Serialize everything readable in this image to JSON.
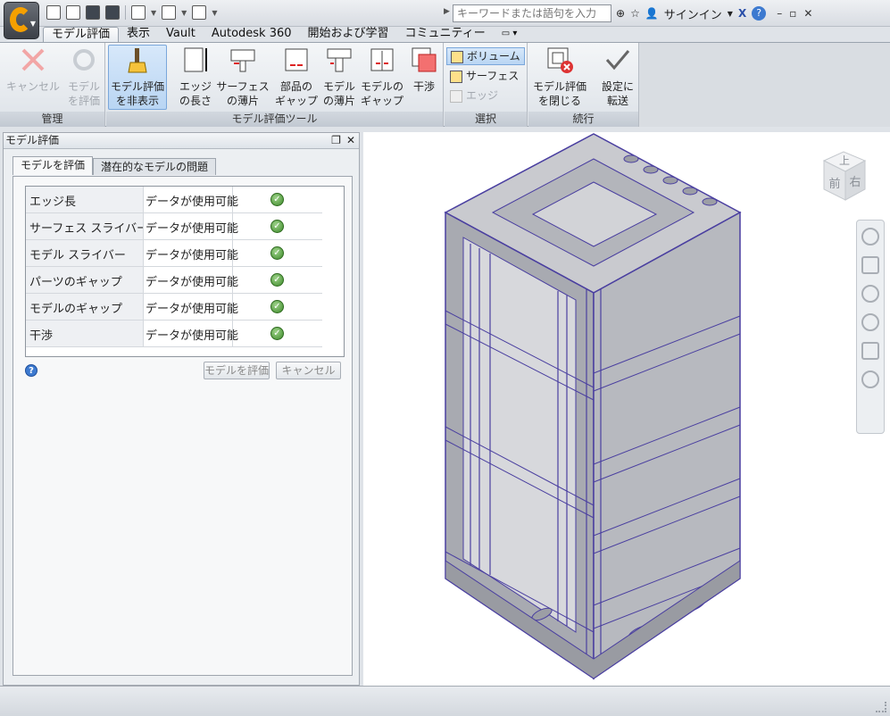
{
  "title_bar": {
    "search_placeholder": "キーワードまたは語句を入力",
    "signin_label": "サインイン"
  },
  "ribbon_tabs": [
    "モデル評価",
    "表示",
    "Vault",
    "Autodesk 360",
    "開始および学習",
    "コミュニティー"
  ],
  "ribbon": {
    "manage_panel": {
      "title": "管理",
      "cancel_label": "キャンセル",
      "evaluate_label_1": "モデル",
      "evaluate_label_2": "を評価"
    },
    "tools_panel": {
      "title": "モデル評価ツール",
      "hide_label_1": "モデル評価",
      "hide_label_2": "を非表示",
      "edge_length_1": "エッジ",
      "edge_length_2": "の長さ",
      "surface_sliver_1": "サーフェス",
      "surface_sliver_2": "の薄片",
      "part_gap_1": "部品の",
      "part_gap_2": "ギャップ",
      "model_sliver_1": "モデル",
      "model_sliver_2": "の薄片",
      "model_gap_1": "モデルの",
      "model_gap_2": "ギャップ",
      "interference": "干渉"
    },
    "select_panel": {
      "title": "選択",
      "volume": "ボリューム",
      "surface": "サーフェス",
      "edge": "エッジ"
    },
    "continue_panel": {
      "title": "続行",
      "close_1": "モデル評価",
      "close_2": "を閉じる",
      "transfer_1": "設定に",
      "transfer_2": "転送"
    }
  },
  "left_panel": {
    "title": "モデル評価",
    "tabs": [
      "モデルを評価",
      "潜在的なモデルの問題"
    ],
    "rows": [
      {
        "name": "エッジ長",
        "status": "データが使用可能"
      },
      {
        "name": "サーフェス スライバー",
        "status": "データが使用可能"
      },
      {
        "name": "モデル スライバー",
        "status": "データが使用可能"
      },
      {
        "name": "パーツのギャップ",
        "status": "データが使用可能"
      },
      {
        "name": "モデルのギャップ",
        "status": "データが使用可能"
      },
      {
        "name": "干渉",
        "status": "データが使用可能"
      }
    ],
    "help_label": "?",
    "evaluate_button": "モデルを評価",
    "cancel_button": "キャンセル"
  },
  "viewcube": {
    "top": "上",
    "front": "前",
    "right": "右"
  },
  "colors": {
    "accent": "#f5a000",
    "selection": "#b9d5f3",
    "model_edge": "#4a3fa0",
    "model_fill": "#a9abb3"
  }
}
